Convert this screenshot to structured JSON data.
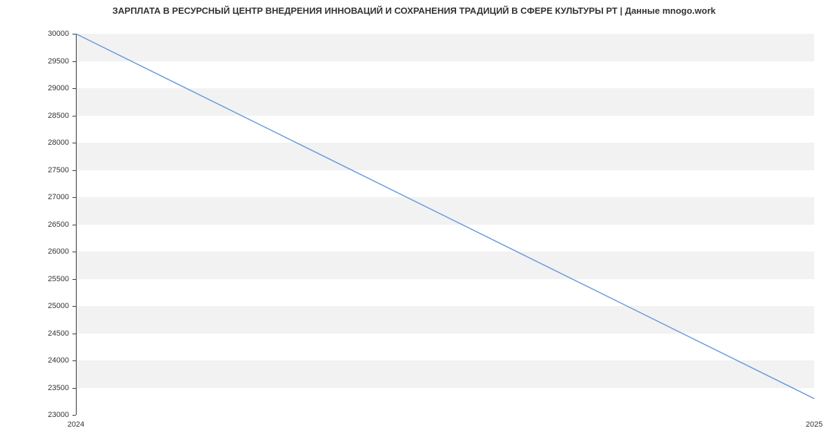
{
  "chart_data": {
    "type": "line",
    "title": "ЗАРПЛАТА В РЕСУРСНЫЙ ЦЕНТР ВНЕДРЕНИЯ ИННОВАЦИЙ И СОХРАНЕНИЯ ТРАДИЦИЙ В СФЕРЕ КУЛЬТУРЫ РТ | Данные mnogo.work",
    "xlabel": "",
    "ylabel": "",
    "x": [
      "2024",
      "2025"
    ],
    "values": [
      30000,
      23300
    ],
    "x_tick_labels": [
      "2024",
      "2025"
    ],
    "y_tick_labels": [
      "23000",
      "23500",
      "24000",
      "24500",
      "25000",
      "25500",
      "26000",
      "26500",
      "27000",
      "27500",
      "28000",
      "28500",
      "29000",
      "29500",
      "30000"
    ],
    "ylim": [
      23000,
      30000
    ],
    "colors": {
      "line": "#6699dd",
      "band": "#f2f2f2"
    }
  }
}
